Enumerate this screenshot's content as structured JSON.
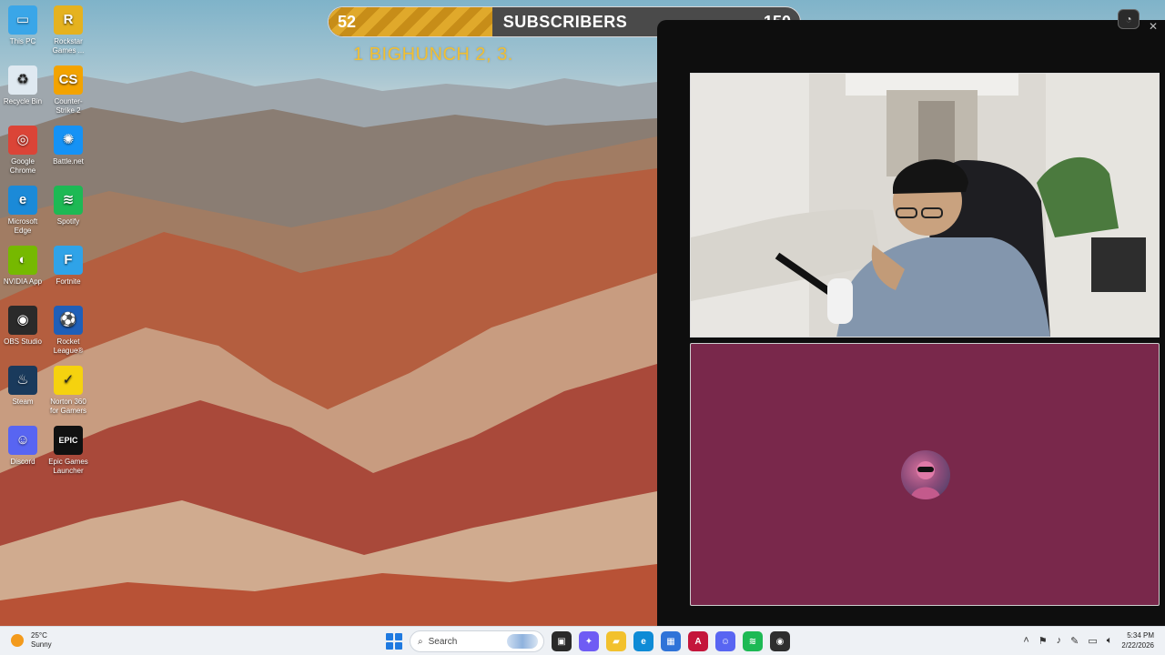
{
  "goal": {
    "current": "52",
    "title": "SUBSCRIBERS",
    "target": "150",
    "fill_fraction": 0.3467,
    "ticker_text": "1 BIGHUNCH  2, 3."
  },
  "desktop_icons": [
    {
      "label": "This PC",
      "icon": "monitor-icon"
    },
    {
      "label": "Rockstar Games ...",
      "icon": "rockstar-icon"
    },
    {
      "label": "Recycle Bin",
      "icon": "recycle-bin-icon"
    },
    {
      "label": "Counter-Strike 2",
      "icon": "counter-strike-icon"
    },
    {
      "label": "Google Chrome",
      "icon": "chrome-icon"
    },
    {
      "label": "Battle.net",
      "icon": "battlenet-icon"
    },
    {
      "label": "Microsoft Edge",
      "icon": "edge-icon"
    },
    {
      "label": "Spotify",
      "icon": "spotify-icon"
    },
    {
      "label": "NVIDIA App",
      "icon": "nvidia-icon"
    },
    {
      "label": "Fortnite",
      "icon": "fortnite-icon"
    },
    {
      "label": "OBS Studio",
      "icon": "obs-icon"
    },
    {
      "label": "Rocket League®",
      "icon": "rocket-league-icon"
    },
    {
      "label": "Steam",
      "icon": "steam-icon"
    },
    {
      "label": "Norton 360 for Gamers",
      "icon": "norton-icon"
    },
    {
      "label": "Discord",
      "icon": "discord-icon"
    },
    {
      "label": "Epic Games Launcher",
      "icon": "epic-games-icon"
    }
  ],
  "taskbar": {
    "weather_temp": "25°C",
    "weather_desc": "Sunny",
    "search_placeholder": "Search",
    "time": "5:34 PM",
    "date": "2/22/2026"
  },
  "colors": {
    "goal_fill": "#e0a92b",
    "ticker": "#f2bf32",
    "voice_tile": "#79284b",
    "panel": "#0e0e0e"
  }
}
